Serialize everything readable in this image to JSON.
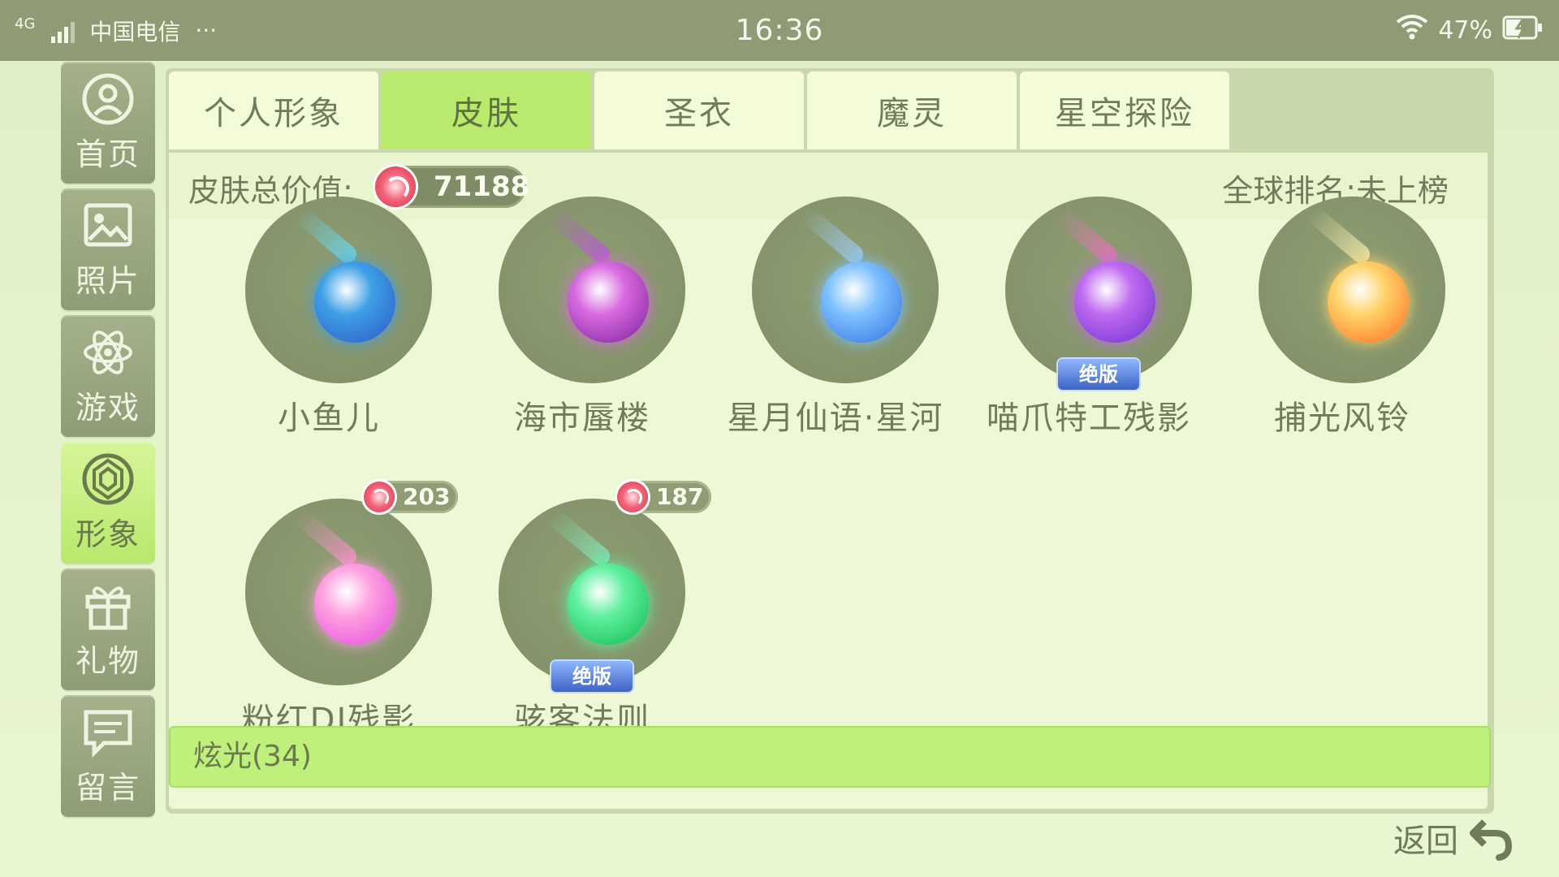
{
  "status_bar": {
    "network": "4G",
    "carrier": "中国电信",
    "more": "···",
    "time": "16:36",
    "battery": "47%"
  },
  "sidebar": {
    "items": [
      {
        "label": "首页",
        "icon": "user-icon",
        "active": false
      },
      {
        "label": "照片",
        "icon": "photo-icon",
        "active": false
      },
      {
        "label": "游戏",
        "icon": "atom-icon",
        "active": false
      },
      {
        "label": "形象",
        "icon": "gem-icon",
        "active": true
      },
      {
        "label": "礼物",
        "icon": "gift-icon",
        "active": false
      },
      {
        "label": "留言",
        "icon": "message-icon",
        "active": false
      }
    ]
  },
  "tabs": [
    {
      "label": "个人形象",
      "active": false
    },
    {
      "label": "皮肤",
      "active": true
    },
    {
      "label": "圣衣",
      "active": false
    },
    {
      "label": "魔灵",
      "active": false
    },
    {
      "label": "星空探险",
      "active": false
    }
  ],
  "summary": {
    "value_label": "皮肤总价值:",
    "total_value": "71188",
    "rank_text": "全球排名:未上榜"
  },
  "skins": [
    {
      "name": "小鱼儿",
      "orb": "#3fa0e6",
      "orb2": "#2b56c8",
      "trail": "#66e0ff",
      "badge": "",
      "price": ""
    },
    {
      "name": "海市蜃楼",
      "orb": "#d86ae0",
      "orb2": "#7a1f9a",
      "trail": "#c050e0",
      "badge": "",
      "price": ""
    },
    {
      "name": "星月仙语·星河",
      "orb": "#7fc2ff",
      "orb2": "#2f6fe0",
      "trail": "#9fd0ff",
      "badge": "",
      "price": ""
    },
    {
      "name": "喵爪特工残影",
      "orb": "#c06af0",
      "orb2": "#6a2fd0",
      "trail": "#f070c0",
      "badge": "绝版",
      "price": ""
    },
    {
      "name": "捕光风铃",
      "orb": "#ffd36a",
      "orb2": "#ff6a1f",
      "trail": "#fff2b0",
      "badge": "",
      "price": ""
    },
    {
      "name": "粉红DJ残影",
      "orb": "#ff9fe0",
      "orb2": "#e04adf",
      "trail": "#ff8fd0",
      "badge": "",
      "price": "203"
    },
    {
      "name": "骇客法则",
      "orb": "#5ff0a0",
      "orb2": "#0fb84a",
      "trail": "#7ff0c0",
      "badge": "绝版",
      "price": "187"
    }
  ],
  "section": {
    "label": "炫光(34)"
  },
  "back": {
    "label": "返回",
    "icon": "back-arrow-icon"
  }
}
